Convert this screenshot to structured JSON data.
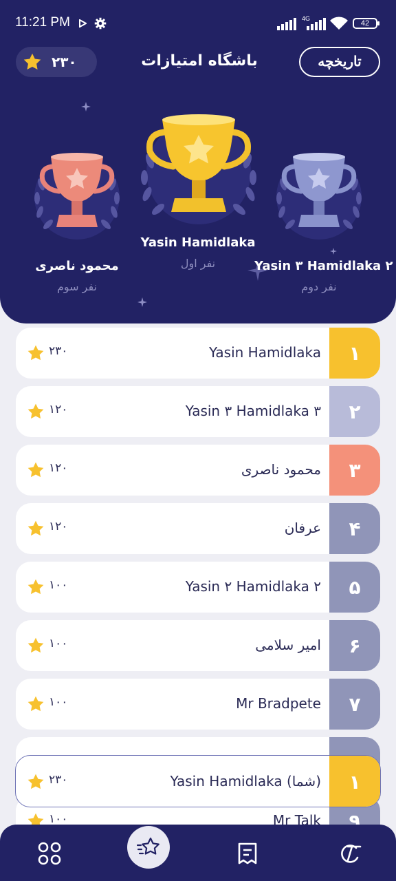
{
  "status_bar": {
    "time": "11:21 PM",
    "network": "4G",
    "battery": "42"
  },
  "header": {
    "title": "باشگاه امتیازات",
    "points": "۲۳۰",
    "history_label": "تاریخچه"
  },
  "podium": {
    "first": {
      "name": "Yasin Hamidlaka",
      "place": "نفر اول"
    },
    "second": {
      "name": "Yasin ۳ Hamidlaka ۲",
      "place": "نفر دوم"
    },
    "third": {
      "name": "محمود ناصری",
      "place": "نفر سوم"
    }
  },
  "leaderboard": [
    {
      "rank": "۱",
      "name": "Yasin Hamidlaka",
      "points": "۲۳۰",
      "color": "#f7c12e"
    },
    {
      "rank": "۲",
      "name": "Yasin ۳ Hamidlaka ۳",
      "points": "۱۲۰",
      "color": "#b8bbd9"
    },
    {
      "rank": "۳",
      "name": "محمود ناصری",
      "points": "۱۲۰",
      "color": "#f4917a"
    },
    {
      "rank": "۴",
      "name": "عرفان",
      "points": "۱۲۰",
      "color": "#9095b8"
    },
    {
      "rank": "۵",
      "name": "Yasin ۲ Hamidlaka ۲",
      "points": "۱۰۰",
      "color": "#9095b8"
    },
    {
      "rank": "۶",
      "name": "امیر سلامی",
      "points": "۱۰۰",
      "color": "#9095b8"
    },
    {
      "rank": "۷",
      "name": "Mr Bradpete",
      "points": "۱۰۰",
      "color": "#9095b8"
    },
    {
      "rank": "",
      "name": "",
      "points": "",
      "color": "#9095b8"
    },
    {
      "rank": "۹",
      "name": "Mr Talk",
      "points": "۱۰۰",
      "color": "#9095b8"
    }
  ],
  "my_rank": {
    "rank": "۱",
    "name": "Yasin Hamidlaka  (شما)",
    "points": "۲۳۰"
  },
  "colors": {
    "primary": "#222264",
    "gold": "#f7c12e",
    "silver": "#8e97cf",
    "bronze": "#ec8a7a"
  },
  "nav": [
    "apps-icon",
    "leaderboard-star-icon",
    "receipt-icon",
    "coupon-icon"
  ]
}
